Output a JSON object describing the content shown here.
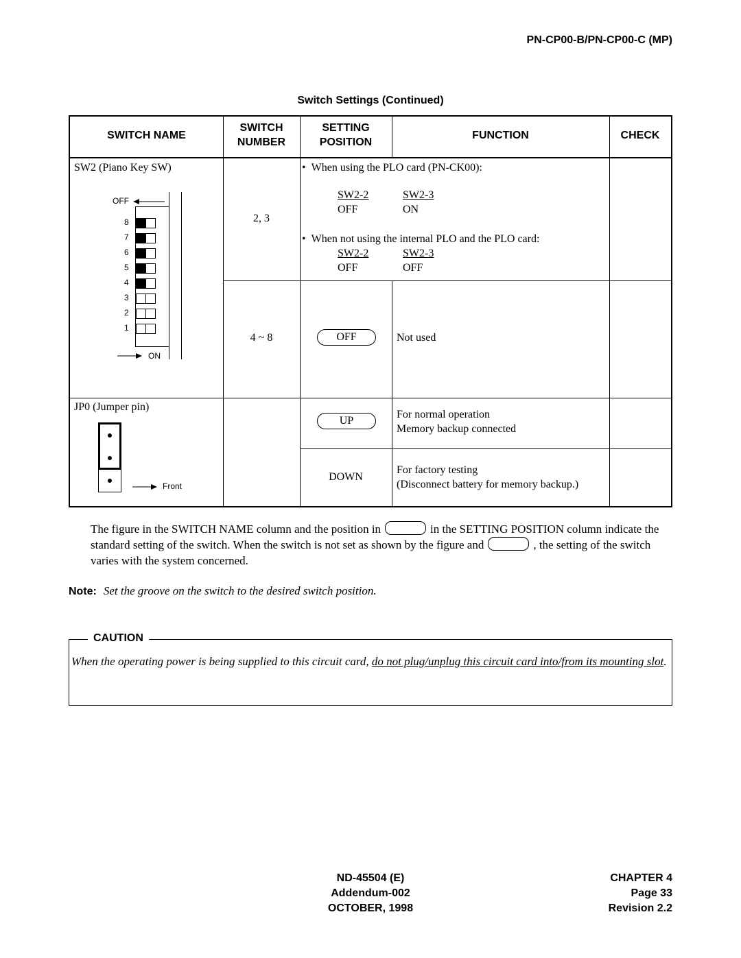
{
  "header": {
    "doc_title": "PN-CP00-B/PN-CP00-C (MP)"
  },
  "table": {
    "caption": "Switch Settings (Continued)",
    "columns": {
      "switch_name": "SWITCH NAME",
      "switch_number_l1": "SWITCH",
      "switch_number_l2": "NUMBER",
      "setting_position_l1": "SETTING",
      "setting_position_l2": "POSITION",
      "function": "FUNCTION",
      "check": "CHECK"
    },
    "sw2": {
      "name": "SW2 (Piano Key SW)",
      "figure": {
        "off_label": "OFF",
        "on_label": "ON",
        "keys": [
          {
            "number": "8",
            "state": "OFF"
          },
          {
            "number": "7",
            "state": "OFF"
          },
          {
            "number": "6",
            "state": "OFF"
          },
          {
            "number": "5",
            "state": "OFF"
          },
          {
            "number": "4",
            "state": "OFF"
          },
          {
            "number": "3",
            "state": "ON"
          },
          {
            "number": "2",
            "state": "ON"
          },
          {
            "number": "1",
            "state": "ON"
          }
        ]
      },
      "rows": [
        {
          "switch_number": "2, 3",
          "function": {
            "bullet1": "When using the PLO card (PN-CK00):",
            "case1": {
              "col1_head": "SW2-2",
              "col2_head": "SW2-3",
              "col1_val": "OFF",
              "col2_val": "ON"
            },
            "bullet2": "When not using the internal PLO and the PLO card:",
            "case2": {
              "col1_head": "SW2-2",
              "col2_head": "SW2-3",
              "col1_val": "OFF",
              "col2_val": "OFF"
            }
          }
        },
        {
          "switch_number": "4 ~ 8",
          "setting_position": "OFF",
          "function": "Not used"
        }
      ]
    },
    "jp0": {
      "name": "JP0 (Jumper pin)",
      "figure": {
        "front_label": "Front"
      },
      "rows": [
        {
          "setting_position": "UP",
          "function_l1": "For normal operation",
          "function_l2": "Memory backup connected"
        },
        {
          "setting_position": "DOWN",
          "function_l1": "For factory testing",
          "function_l2": "(Disconnect battery for memory backup.)"
        }
      ]
    }
  },
  "explanation": {
    "part1": "The figure in the SWITCH NAME column and the position in",
    "part2": "in the SETTING POSITION column indicate the standard setting of the switch. When the switch is not set as shown by the figure and",
    "part3": ", the setting of the switch varies with the system concerned."
  },
  "note": {
    "label": "Note:",
    "text": "Set the groove on the switch to the desired switch position."
  },
  "caution": {
    "label": "CAUTION",
    "text_plain": "When the operating power is being supplied to this circuit card, ",
    "text_underlined": "do not plug/unplug this circuit card into/from its mounting slot",
    "text_end": "."
  },
  "footer": {
    "doc_number": "ND-45504 (E)",
    "addendum": "Addendum-002",
    "date": "OCTOBER, 1998",
    "chapter": "CHAPTER 4",
    "page": "Page 33",
    "revision": "Revision 2.2"
  }
}
